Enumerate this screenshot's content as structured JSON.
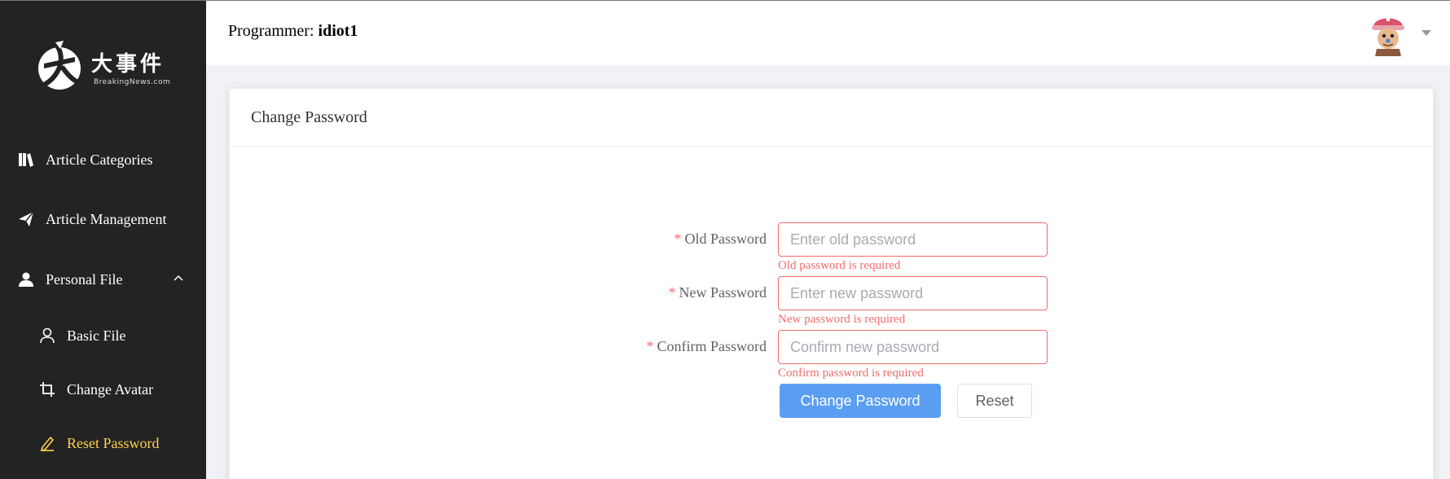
{
  "brand": {
    "name_cn": "大事件",
    "name_en": "BreakingNews.com"
  },
  "sidebar": {
    "items": [
      {
        "label": "Article Categories",
        "icon": "book-icon"
      },
      {
        "label": "Article Management",
        "icon": "paper-plane-icon"
      },
      {
        "label": "Personal File",
        "icon": "user-icon",
        "expanded": true
      },
      {
        "label": "Basic File",
        "icon": "user-outline-icon"
      },
      {
        "label": "Change Avatar",
        "icon": "crop-icon"
      },
      {
        "label": "Reset Password",
        "icon": "edit-pen-icon",
        "active": true
      }
    ]
  },
  "header": {
    "prefix": "Programmer:",
    "username": "idiot1"
  },
  "card": {
    "title": "Change Password"
  },
  "form": {
    "old": {
      "label": "Old Password",
      "placeholder": "Enter old password",
      "error": "Old password is required"
    },
    "new": {
      "label": "New Password",
      "placeholder": "Enter new password",
      "error": "New password is required"
    },
    "confirm": {
      "label": "Confirm Password",
      "placeholder": "Confirm new password",
      "error": "Confirm password is required"
    },
    "required_mark": "*",
    "submit_label": "Change Password",
    "reset_label": "Reset"
  },
  "colors": {
    "sidebar_bg": "#232323",
    "active": "#ffd04b",
    "error": "#f56c6c",
    "primary": "#5a9ef2"
  }
}
